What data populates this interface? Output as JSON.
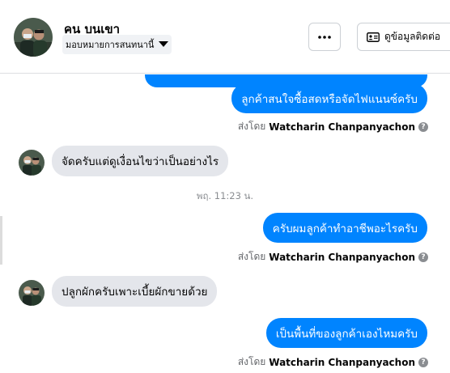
{
  "header": {
    "name": "คน บนเขา",
    "assign_label": "มอบหมายการสนทนานี้",
    "info_button_label": "ดูข้อมูลติดต่อ"
  },
  "messages": [
    {
      "type": "outgoing",
      "text": "ลูกค้าสนใจซื้อสดหรือจัดไฟแนนซ์ครับ",
      "sent_by_prefix": "ส่งโดย",
      "sent_by_name": "Watcharin Chanpanyachon"
    },
    {
      "type": "incoming",
      "text": "จัดครับแต่ดูเงื่อนไขว่าเป็นอย่างไร"
    },
    {
      "type": "timestamp",
      "text": "พฤ. 11:23 น."
    },
    {
      "type": "outgoing",
      "text": "ครับผมลูกค้าทำอาชีพอะไรครับ",
      "sent_by_prefix": "ส่งโดย",
      "sent_by_name": "Watcharin Chanpanyachon"
    },
    {
      "type": "incoming",
      "text": "ปลูกผักครับเพาะเบี้ยผักขายด้วย"
    },
    {
      "type": "outgoing",
      "text": "เป็นพื้นที่ของลูกค้าเองไหมครับ",
      "sent_by_prefix": "ส่งโดย",
      "sent_by_name": "Watcharin Chanpanyachon"
    }
  ],
  "colors": {
    "outgoing_bubble": "#0084ff",
    "incoming_bubble": "#e4e6eb",
    "secondary_text": "#65676b"
  },
  "icons": {
    "more": "more-horizontal-icon",
    "contact_card": "contact-card-icon",
    "dropdown": "caret-down-icon",
    "help": "question-circle-icon"
  }
}
